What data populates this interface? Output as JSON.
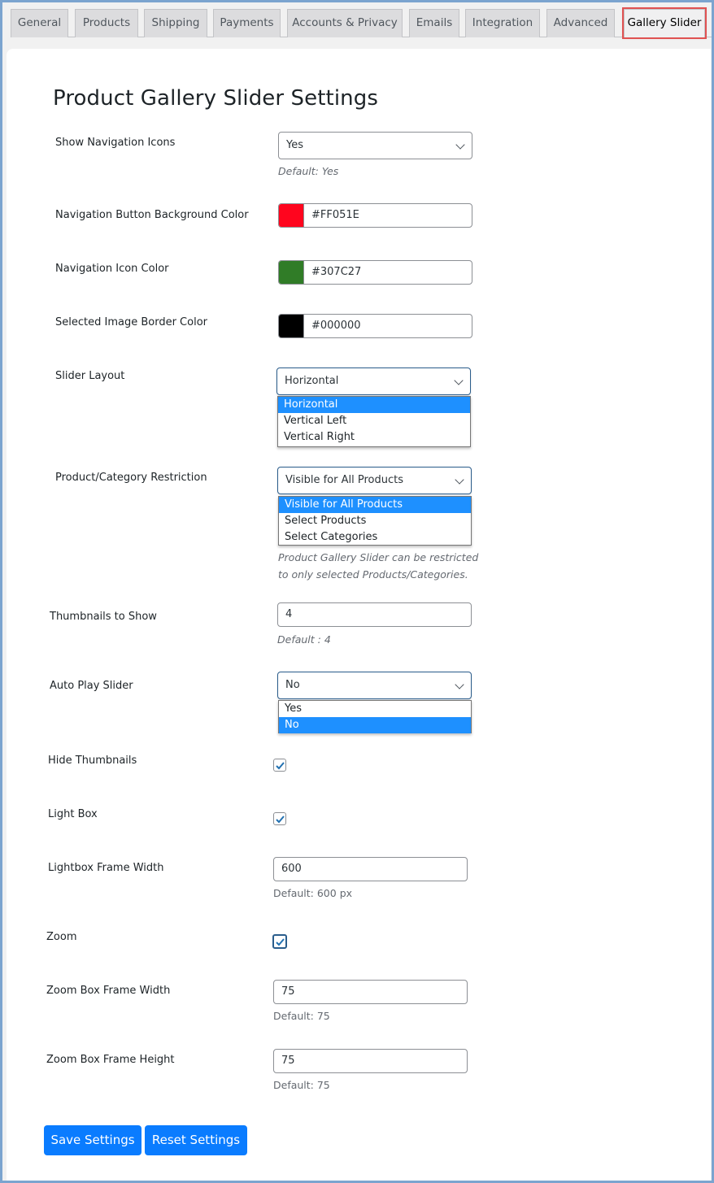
{
  "tabs": [
    {
      "label": "General",
      "active": false
    },
    {
      "label": "Products",
      "active": false
    },
    {
      "label": "Shipping",
      "active": false
    },
    {
      "label": "Payments",
      "active": false
    },
    {
      "label": "Accounts & Privacy",
      "active": false
    },
    {
      "label": "Emails",
      "active": false
    },
    {
      "label": "Integration",
      "active": false
    },
    {
      "label": "Advanced",
      "active": false
    },
    {
      "label": "Gallery Slider",
      "active": true
    }
  ],
  "page_title": "Product Gallery Slider Settings",
  "fields": {
    "show_nav_icons": {
      "label": "Show Navigation Icons",
      "value": "Yes",
      "hint": "Default: Yes"
    },
    "nav_btn_bg_color": {
      "label": "Navigation Button Background Color",
      "value": "#FF051E",
      "swatch": "#FF051E"
    },
    "nav_icon_color": {
      "label": "Navigation Icon Color",
      "value": "#307C27",
      "swatch": "#307C27"
    },
    "selected_border_color": {
      "label": "Selected Image Border Color",
      "value": "#000000",
      "swatch": "#000000"
    },
    "slider_layout": {
      "label": "Slider Layout",
      "value": "Horizontal",
      "options": [
        "Horizontal",
        "Vertical Left",
        "Vertical Right"
      ],
      "selected_index": 0
    },
    "restriction": {
      "label": "Product/Category Restriction",
      "value": "Visible for All Products",
      "options": [
        "Visible for All Products",
        "Select Products",
        "Select Categories"
      ],
      "selected_index": 0,
      "hint_line1": "Product Gallery Slider can be restricted",
      "hint_line2": "to only selected Products/Categories."
    },
    "thumbnails_to_show": {
      "label": "Thumbnails to Show",
      "value": "4",
      "hint": "Default : 4"
    },
    "auto_play": {
      "label": "Auto Play Slider",
      "value": "No",
      "options": [
        "Yes",
        "No"
      ],
      "selected_index": 1
    },
    "hide_thumbnails": {
      "label": "Hide Thumbnails",
      "checked": true
    },
    "light_box": {
      "label": "Light Box",
      "checked": true
    },
    "lightbox_width": {
      "label": "Lightbox Frame Width",
      "value": "600",
      "hint": "Default: 600 px"
    },
    "zoom": {
      "label": "Zoom",
      "checked": true
    },
    "zoom_width": {
      "label": "Zoom Box Frame Width",
      "value": "75",
      "hint": "Default: 75"
    },
    "zoom_height": {
      "label": "Zoom Box Frame Height",
      "value": "75",
      "hint": "Default: 75"
    }
  },
  "buttons": {
    "save": "Save Settings",
    "reset": "Reset Settings"
  },
  "colors": {
    "primary_button": "#0A7CFF",
    "option_highlight": "#1E90FF",
    "active_tab_outline": "#E05252"
  }
}
